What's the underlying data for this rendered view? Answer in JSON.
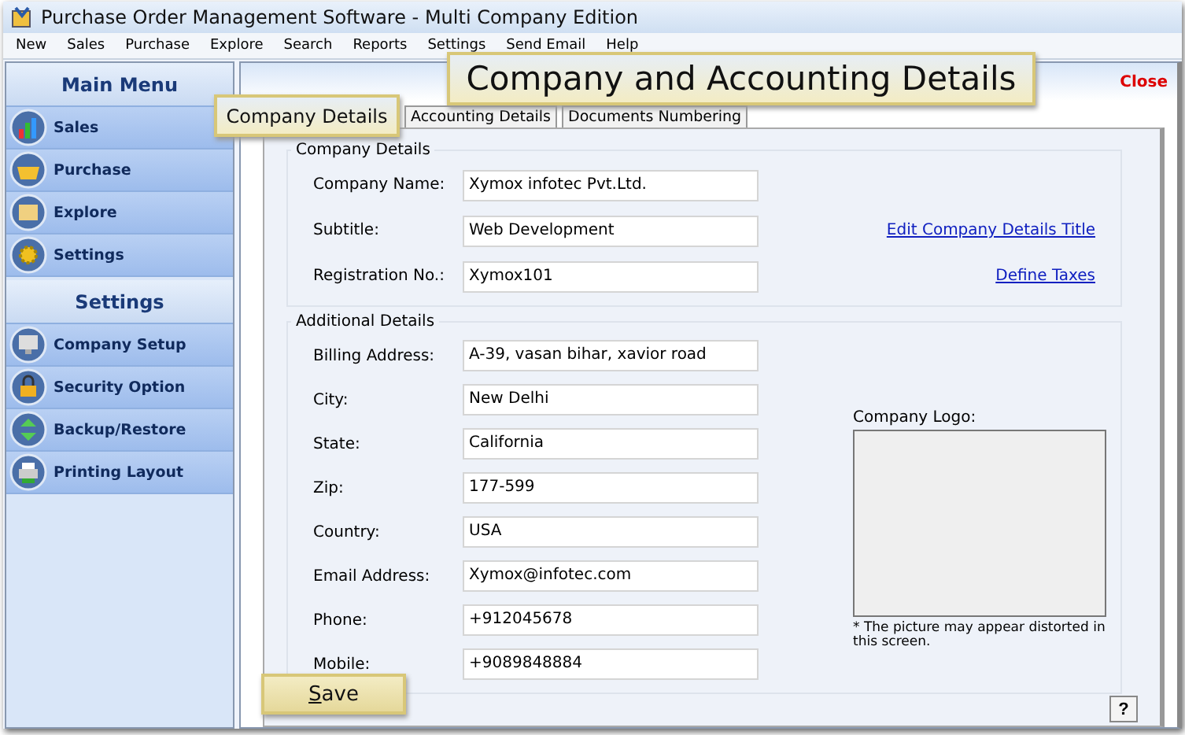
{
  "window": {
    "title": "Purchase Order Management Software - Multi Company Edition"
  },
  "menu": [
    "New",
    "Sales",
    "Purchase",
    "Explore",
    "Search",
    "Reports",
    "Settings",
    "Send Email",
    "Help"
  ],
  "sidebar": [
    {
      "heading": "Main Menu",
      "items": [
        "Sales",
        "Purchase",
        "Explore",
        "Settings"
      ]
    },
    {
      "heading": "Settings",
      "items": [
        "Company Setup",
        "Security Option",
        "Backup/Restore",
        "Printing Layout"
      ]
    }
  ],
  "close": "Close",
  "tabs": [
    "Accounting Details",
    "Documents Numbering"
  ],
  "company_details": {
    "title": "Company Details",
    "fields": [
      {
        "label": "Company Name:",
        "value": "Xymox infotec Pvt.Ltd."
      },
      {
        "label": "Subtitle:",
        "value": "Web Development",
        "link": "Edit Company Details Title"
      },
      {
        "label": "Registration No.:",
        "value": "Xymox101",
        "link": "Define Taxes"
      }
    ]
  },
  "additional_details": {
    "title": "Additional Details",
    "fields": [
      {
        "label": "Billing Address:",
        "value": "A-39, vasan bihar, xavior road"
      },
      {
        "label": "City:",
        "value": "New Delhi"
      },
      {
        "label": "State:",
        "value": "California"
      },
      {
        "label": "Zip:",
        "value": "177-599"
      },
      {
        "label": "Country:",
        "value": "USA"
      },
      {
        "label": "Email Address:",
        "value": "Xymox@infotec.com"
      },
      {
        "label": "Phone:",
        "value": "+912045678"
      },
      {
        "label": "Mobile:",
        "value": "+9089848884"
      }
    ],
    "logo_label": "Company Logo:",
    "logo_note": "* The picture may appear distorted in this screen."
  },
  "help": "?",
  "callouts": [
    "Company and Accounting Details",
    "Company Details",
    "Save"
  ]
}
